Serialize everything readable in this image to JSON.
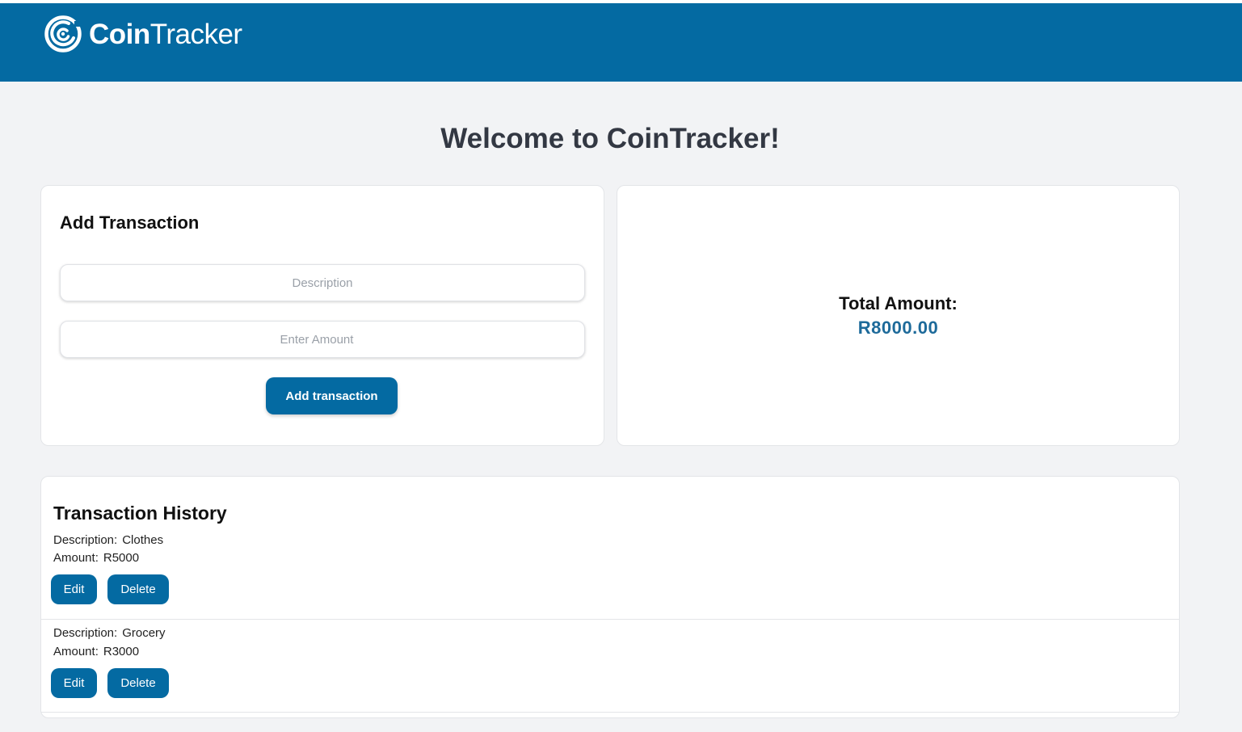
{
  "app": {
    "brand_part1": "Coin",
    "brand_part2": "Tracker",
    "logo_icon": "coin-swirl-icon",
    "accent_color": "#046aa2",
    "background_color": "#f2f3f5"
  },
  "welcome": {
    "title": "Welcome to CoinTracker!"
  },
  "add_transaction": {
    "title": "Add Transaction",
    "description_placeholder": "Description",
    "description_value": "",
    "amount_placeholder": "Enter Amount",
    "amount_value": "",
    "button_label": "Add transaction"
  },
  "summary": {
    "total_label": "Total Amount:",
    "total_value": "R8000.00"
  },
  "history": {
    "title": "Transaction History",
    "description_label": "Description:",
    "amount_label": "Amount:",
    "edit_label": "Edit",
    "delete_label": "Delete",
    "transactions": [
      {
        "description": "Clothes",
        "amount": "R5000"
      },
      {
        "description": "Grocery",
        "amount": "R3000"
      }
    ]
  }
}
